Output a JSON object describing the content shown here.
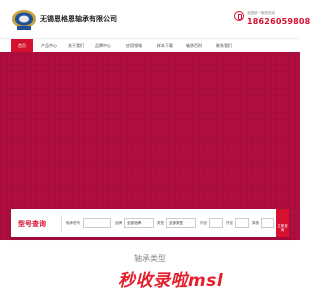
{
  "header": {
    "company_name": "无锡恩格恩轴承有限公司",
    "hotline_label": "全国统一服务热线",
    "hotline_number": "18626059808"
  },
  "nav": {
    "items": [
      {
        "label": "首页",
        "active": true
      },
      {
        "label": "产品中心",
        "active": false
      },
      {
        "label": "关于我们",
        "active": false
      },
      {
        "label": "品牌中心",
        "active": false
      },
      {
        "label": "应用领域",
        "active": false
      },
      {
        "label": "样本下载",
        "active": false
      },
      {
        "label": "轴承百科",
        "active": false
      },
      {
        "label": "联系我们",
        "active": false
      }
    ]
  },
  "banner": {
    "color": "#b00e3f"
  },
  "search": {
    "title": "型号查询",
    "model_label": "轴承型号",
    "brand_label": "品牌",
    "brand_value": "全部品牌",
    "type_label": "类型",
    "type_value": "全部类型",
    "inner_label": "内径",
    "outer_label": "外径",
    "thickness_label": "厚度",
    "button_label": "立即查询"
  },
  "section": {
    "title": "轴承类型"
  },
  "watermark": {
    "text": "秒收录啦msl"
  },
  "colors": {
    "accent": "#d4112f"
  }
}
